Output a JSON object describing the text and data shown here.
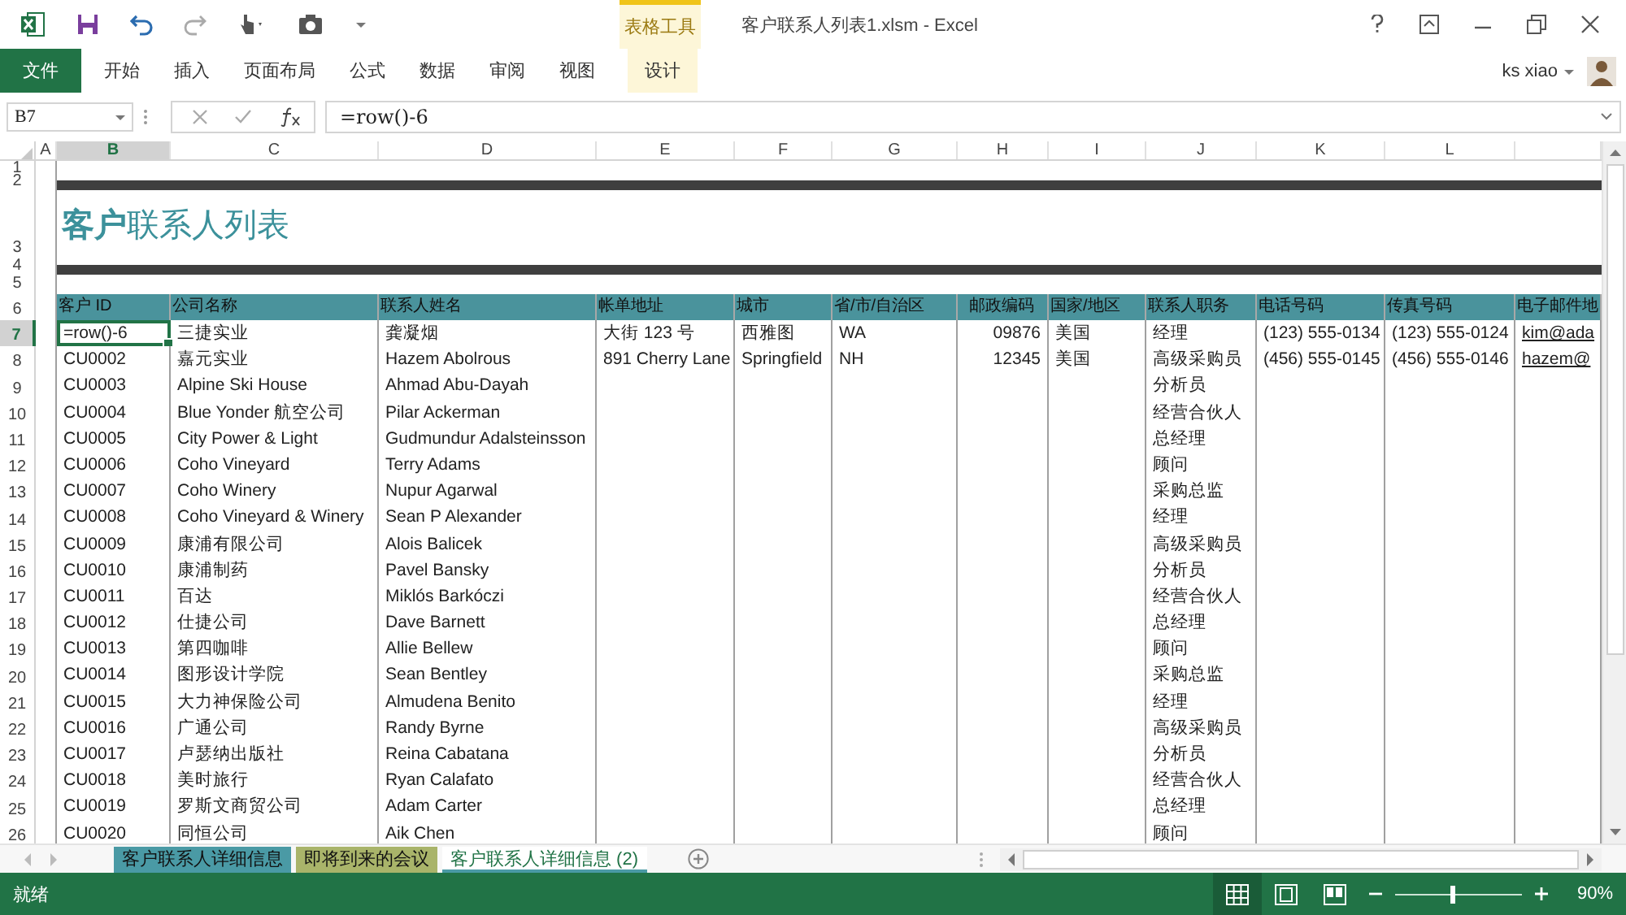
{
  "window": {
    "title": "客户联系人列表1.xlsm - Excel",
    "user": "ks xiao"
  },
  "contextual_group": {
    "label": "表格工具"
  },
  "ribbon_tabs": [
    {
      "label": "文件",
      "kind": "file"
    },
    {
      "label": "开始",
      "kind": "plain"
    },
    {
      "label": "插入",
      "kind": "plain"
    },
    {
      "label": "页面布局",
      "kind": "plain"
    },
    {
      "label": "公式",
      "kind": "plain"
    },
    {
      "label": "数据",
      "kind": "plain"
    },
    {
      "label": "审阅",
      "kind": "plain"
    },
    {
      "label": "视图",
      "kind": "plain"
    },
    {
      "label": "设计",
      "kind": "contextual"
    }
  ],
  "formula_bar": {
    "name_box": "B7",
    "formula": "=row()-6"
  },
  "columns": [
    {
      "letter": "A",
      "selected": false
    },
    {
      "letter": "B",
      "selected": true
    },
    {
      "letter": "C",
      "selected": false
    },
    {
      "letter": "D",
      "selected": false
    },
    {
      "letter": "E",
      "selected": false
    },
    {
      "letter": "F",
      "selected": false
    },
    {
      "letter": "G",
      "selected": false
    },
    {
      "letter": "H",
      "selected": false
    },
    {
      "letter": "I",
      "selected": false
    },
    {
      "letter": "J",
      "selected": false
    },
    {
      "letter": "K",
      "selected": false
    },
    {
      "letter": "L",
      "selected": false
    }
  ],
  "rows": [
    {
      "number": "1",
      "kind": "blank",
      "selected": false
    },
    {
      "number": "2",
      "kind": "rule",
      "selected": false
    },
    {
      "number": "3",
      "kind": "title",
      "selected": false,
      "title": "**客户**联系人列表"
    },
    {
      "number": "4",
      "kind": "rule",
      "selected": false
    },
    {
      "number": "5",
      "kind": "blank",
      "selected": false
    },
    {
      "number": "6",
      "kind": "header",
      "selected": false,
      "headings": [
        "客户 ID",
        "公司名称",
        "联系人姓名",
        "帐单地址",
        "城市",
        "省/市/自治区",
        "邮政编码",
        "国家/地区",
        "联系人职务",
        "电话号码",
        "传真号码",
        "电子邮件地"
      ]
    },
    {
      "number": "7",
      "kind": "data",
      "selected": true,
      "editing": true,
      "cells": {
        "id": "=row()-6",
        "company": "三捷实业",
        "contact": "龚凝烟",
        "address": "大街 123 号",
        "city": "西雅图",
        "state": "WA",
        "zip": "09876",
        "country": "美国",
        "title": "经理",
        "phone": "(123) 555-0134",
        "fax": "(123) 555-0124",
        "email": "kim@ada"
      }
    },
    {
      "number": "8",
      "kind": "data",
      "selected": false,
      "editing": false,
      "cells": {
        "id": "CU0002",
        "company": "嘉元实业",
        "contact": "Hazem Abolrous",
        "address": "891 Cherry Lane",
        "city": "Springfield",
        "state": "NH",
        "zip": "12345",
        "country": "美国",
        "title": "高级采购员",
        "phone": "(456) 555-0145",
        "fax": "(456) 555-0146",
        "email": "hazem@"
      }
    },
    {
      "number": "9",
      "kind": "data",
      "selected": false,
      "editing": false,
      "cells": {
        "id": "CU0003",
        "company": "Alpine Ski House",
        "contact": "Ahmad Abu-Dayah",
        "title": "分析员"
      }
    },
    {
      "number": "10",
      "kind": "data",
      "selected": false,
      "editing": false,
      "cells": {
        "id": "CU0004",
        "company": "Blue Yonder 航空公司",
        "contact": "Pilar Ackerman",
        "title": "经营合伙人"
      }
    },
    {
      "number": "11",
      "kind": "data",
      "selected": false,
      "editing": false,
      "cells": {
        "id": "CU0005",
        "company": "City Power & Light",
        "contact": "Gudmundur Adalsteinsson",
        "title": "总经理"
      }
    },
    {
      "number": "12",
      "kind": "data",
      "selected": false,
      "editing": false,
      "cells": {
        "id": "CU0006",
        "company": "Coho Vineyard",
        "contact": "Terry Adams",
        "title": "顾问"
      }
    },
    {
      "number": "13",
      "kind": "data",
      "selected": false,
      "editing": false,
      "cells": {
        "id": "CU0007",
        "company": "Coho Winery",
        "contact": "Nupur Agarwal",
        "title": "采购总监"
      }
    },
    {
      "number": "14",
      "kind": "data",
      "selected": false,
      "editing": false,
      "cells": {
        "id": "CU0008",
        "company": "Coho Vineyard & Winery",
        "contact": "Sean P Alexander",
        "title": "经理"
      }
    },
    {
      "number": "15",
      "kind": "data",
      "selected": false,
      "editing": false,
      "cells": {
        "id": "CU0009",
        "company": "康浦有限公司",
        "contact": "Alois Balicek",
        "title": "高级采购员"
      }
    },
    {
      "number": "16",
      "kind": "data",
      "selected": false,
      "editing": false,
      "cells": {
        "id": "CU0010",
        "company": "康浦制药",
        "contact": "Pavel Bansky",
        "title": "分析员"
      }
    },
    {
      "number": "17",
      "kind": "data",
      "selected": false,
      "editing": false,
      "cells": {
        "id": "CU0011",
        "company": "百达",
        "contact": "Miklós Barkóczi",
        "title": "经营合伙人"
      }
    },
    {
      "number": "18",
      "kind": "data",
      "selected": false,
      "editing": false,
      "cells": {
        "id": "CU0012",
        "company": "仕捷公司",
        "contact": "Dave Barnett",
        "title": "总经理"
      }
    },
    {
      "number": "19",
      "kind": "data",
      "selected": false,
      "editing": false,
      "cells": {
        "id": "CU0013",
        "company": "第四咖啡",
        "contact": "Allie Bellew",
        "title": "顾问"
      }
    },
    {
      "number": "20",
      "kind": "data",
      "selected": false,
      "editing": false,
      "cells": {
        "id": "CU0014",
        "company": "图形设计学院",
        "contact": "Sean Bentley",
        "title": "采购总监"
      }
    },
    {
      "number": "21",
      "kind": "data",
      "selected": false,
      "editing": false,
      "cells": {
        "id": "CU0015",
        "company": "大力神保险公司",
        "contact": "Almudena Benito",
        "title": "经理"
      }
    },
    {
      "number": "22",
      "kind": "data",
      "selected": false,
      "editing": false,
      "cells": {
        "id": "CU0016",
        "company": "广通公司",
        "contact": "Randy Byrne",
        "title": "高级采购员"
      }
    },
    {
      "number": "23",
      "kind": "data",
      "selected": false,
      "editing": false,
      "cells": {
        "id": "CU0017",
        "company": "卢瑟纳出版社",
        "contact": "Reina Cabatana",
        "title": "分析员"
      }
    },
    {
      "number": "24",
      "kind": "data",
      "selected": false,
      "editing": false,
      "cells": {
        "id": "CU0018",
        "company": "美时旅行",
        "contact": "Ryan Calafato",
        "title": "经营合伙人"
      }
    },
    {
      "number": "25",
      "kind": "data",
      "selected": false,
      "editing": false,
      "cells": {
        "id": "CU0019",
        "company": "罗斯文商贸公司",
        "contact": "Adam Carter",
        "title": "总经理"
      }
    },
    {
      "number": "26",
      "kind": "data",
      "selected": false,
      "editing": false,
      "cells": {
        "id": "CU0020",
        "company": "同恒公司",
        "contact": "Aik Chen",
        "title": "顾问"
      }
    }
  ],
  "sheet_tabs": [
    {
      "label": "客户联系人详细信息",
      "color": "#4a9aa5",
      "selected": false
    },
    {
      "label": "即将到来的会议",
      "color": "#a9b46a",
      "selected": false
    },
    {
      "label": "客户联系人详细信息 (2)",
      "color": "#4a9aa5",
      "selected": true
    }
  ],
  "status_bar": {
    "text": "就绪",
    "views": [
      {
        "kind": "normal",
        "selected": true
      },
      {
        "kind": "page_layout",
        "selected": false
      },
      {
        "kind": "page_break",
        "selected": false
      }
    ],
    "zoom": {
      "level": 0.45,
      "label": "90%"
    }
  }
}
